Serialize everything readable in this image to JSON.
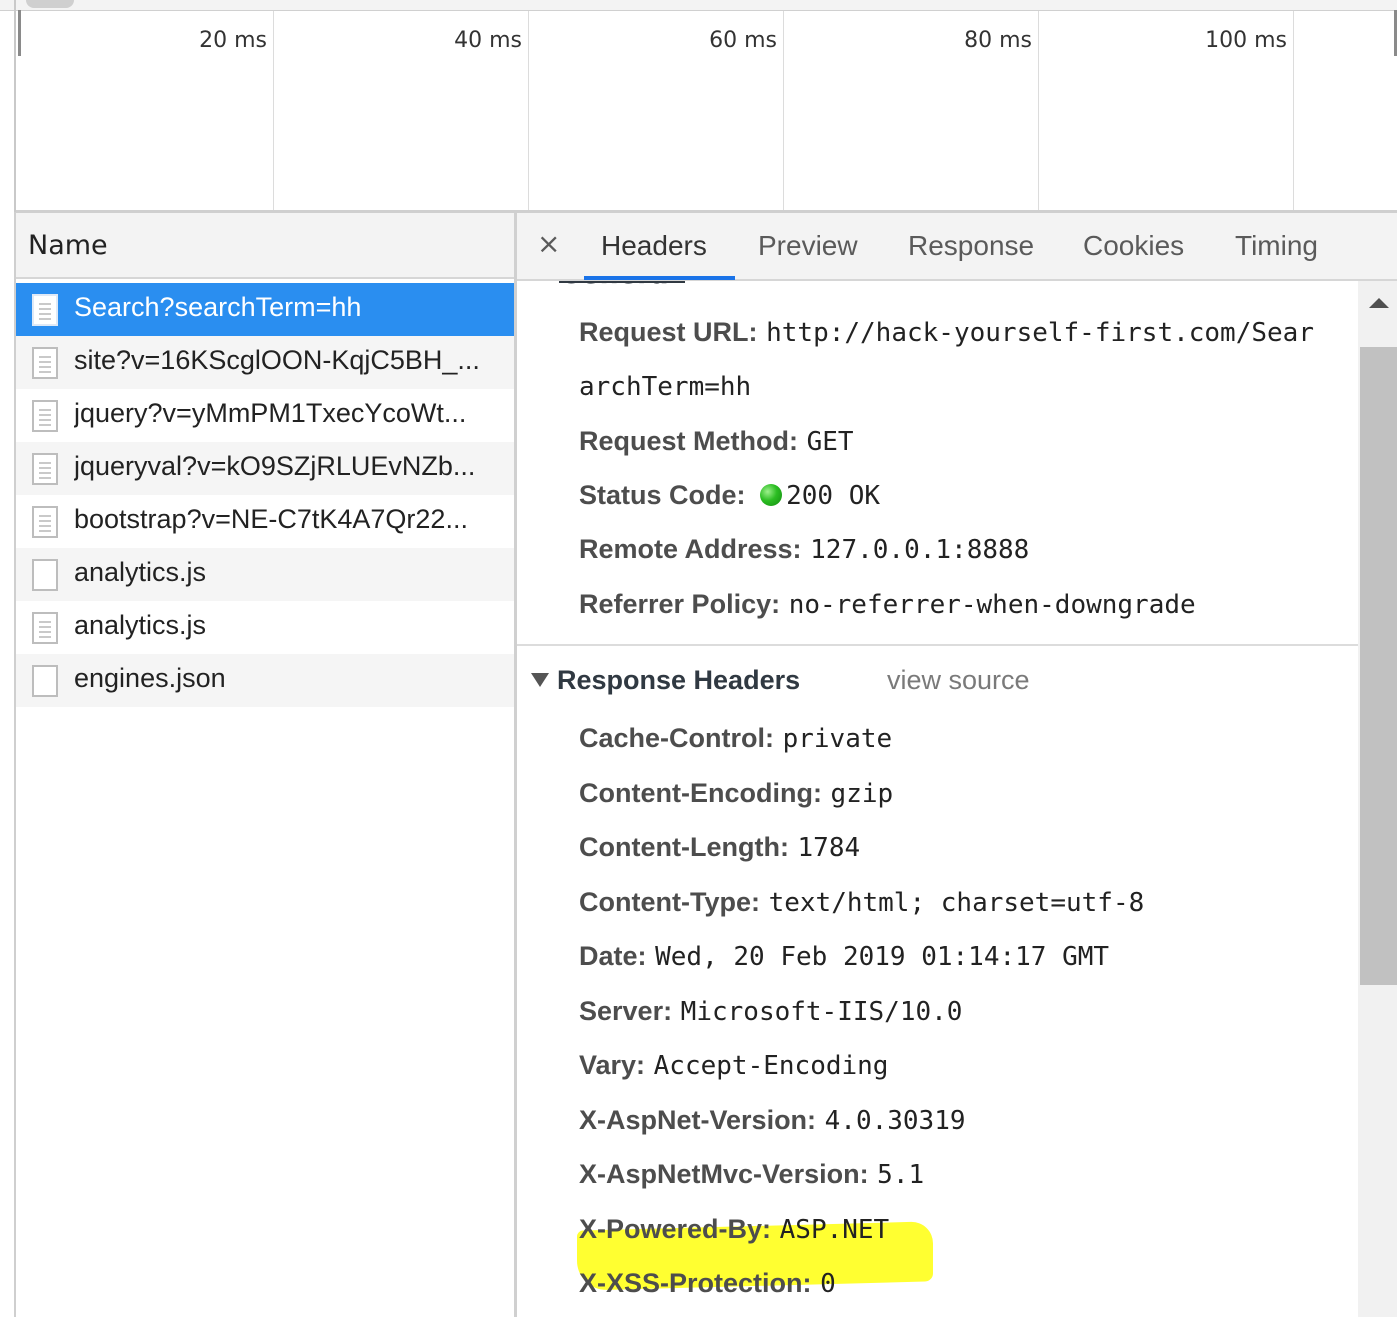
{
  "timeline": {
    "ticks": [
      "20 ms",
      "40 ms",
      "60 ms",
      "80 ms",
      "100 ms"
    ]
  },
  "requests": {
    "column_name": "Name",
    "items": [
      {
        "name": "Search?searchTerm=hh",
        "icon": "document-icon",
        "selected": true
      },
      {
        "name": "site?v=16KScglOON-KqjC5BH_...",
        "icon": "stylesheet-icon"
      },
      {
        "name": "jquery?v=yMmPM1TxecYcoWt...",
        "icon": "script-icon"
      },
      {
        "name": "jqueryval?v=kO9SZjRLUEvNZb...",
        "icon": "script-icon"
      },
      {
        "name": "bootstrap?v=NE-C7tK4A7Qr22...",
        "icon": "script-icon"
      },
      {
        "name": "analytics.js",
        "icon": "blank-file-icon"
      },
      {
        "name": "analytics.js",
        "icon": "script-icon"
      },
      {
        "name": "engines.json",
        "icon": "blank-file-icon"
      }
    ]
  },
  "tabs": {
    "close": "×",
    "items": [
      "Headers",
      "Preview",
      "Response",
      "Cookies",
      "Timing"
    ],
    "active": "Headers"
  },
  "general": {
    "title": "General",
    "rows": [
      {
        "name": "Request URL:",
        "value": "http://hack-yourself-first.com/Sear"
      },
      {
        "name": "",
        "value": "archTerm=hh"
      },
      {
        "name": "Request Method:",
        "value": "GET"
      },
      {
        "name": "Status Code:",
        "value": "200 OK",
        "status_color": "#2bbd22"
      },
      {
        "name": "Remote Address:",
        "value": "127.0.0.1:8888"
      },
      {
        "name": "Referrer Policy:",
        "value": "no-referrer-when-downgrade"
      }
    ]
  },
  "response_headers": {
    "title": "Response Headers",
    "view_source": "view source",
    "rows": [
      {
        "name": "Cache-Control:",
        "value": "private"
      },
      {
        "name": "Content-Encoding:",
        "value": "gzip"
      },
      {
        "name": "Content-Length:",
        "value": "1784"
      },
      {
        "name": "Content-Type:",
        "value": "text/html; charset=utf-8"
      },
      {
        "name": "Date:",
        "value": "Wed, 20 Feb 2019 01:14:17 GMT"
      },
      {
        "name": "Server:",
        "value": "Microsoft-IIS/10.0"
      },
      {
        "name": "Vary:",
        "value": "Accept-Encoding"
      },
      {
        "name": "X-AspNet-Version:",
        "value": "4.0.30319"
      },
      {
        "name": "X-AspNetMvc-Version:",
        "value": "5.1"
      },
      {
        "name": "X-Powered-By:",
        "value": "ASP.NET"
      },
      {
        "name": "X-XSS-Protection:",
        "value": "0"
      }
    ],
    "highlight_color": "#ffff26"
  },
  "colors": {
    "selected_row": "#2a8ef0",
    "tab_underline": "#1a73e8"
  }
}
